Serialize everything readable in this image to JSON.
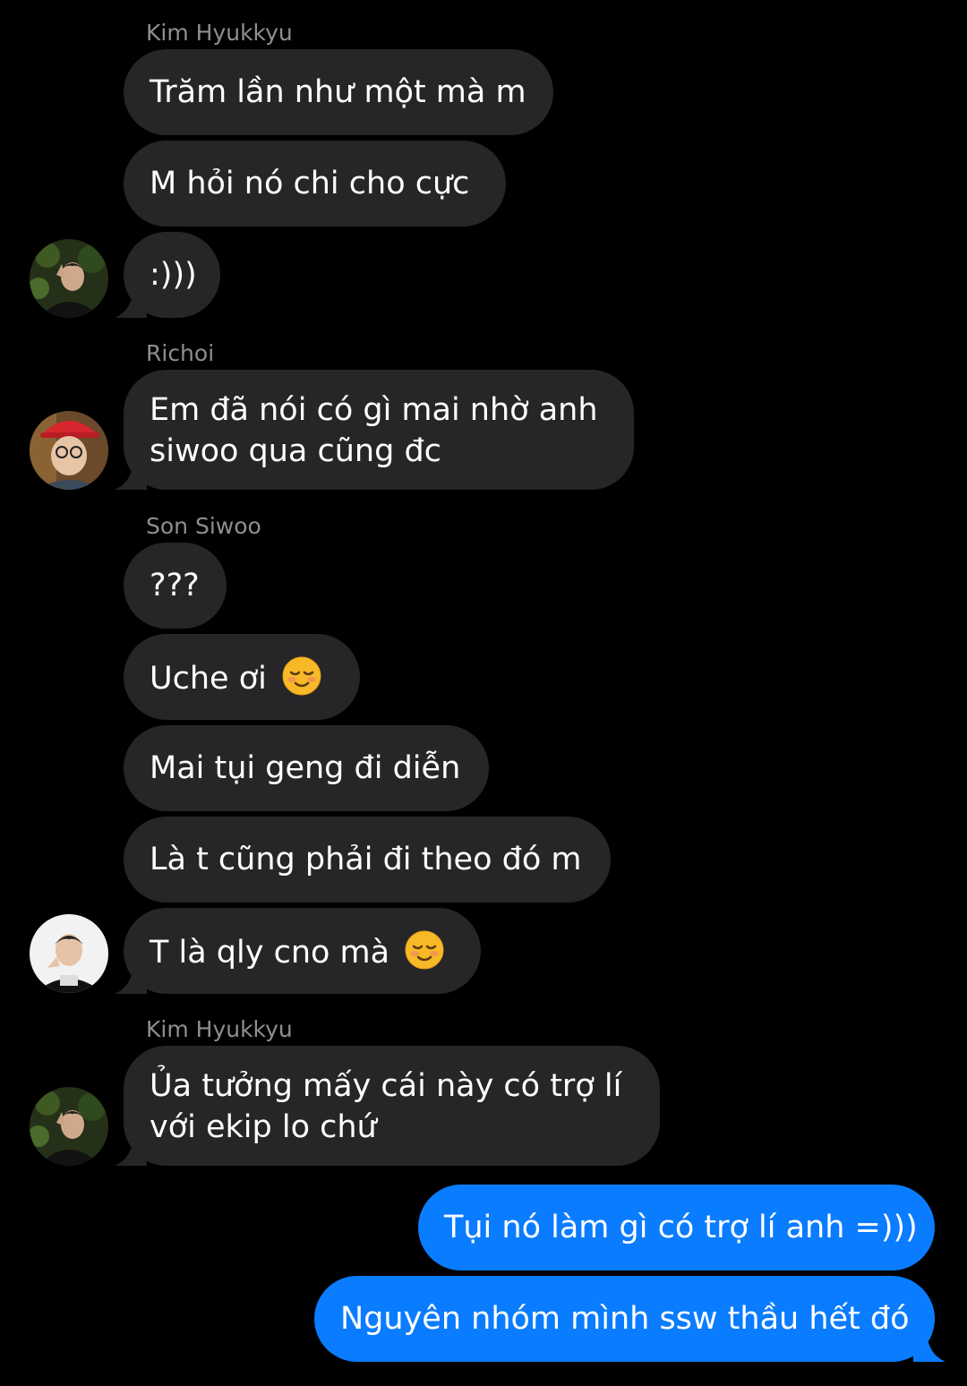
{
  "messages": {
    "s1_name": "Kim Hyukkyu",
    "m1": "Trăm lần như một mà m",
    "m2": "M hỏi nó chi cho cực",
    "m3": ":)))",
    "s2_name": "Richoi",
    "m4_line1": "Em đã nói có gì mai nhờ anh",
    "m4_line2": "siwoo qua cũng đc",
    "s3_name": "Son Siwoo",
    "m5": "???",
    "m6": "Uche ơi",
    "m7": "Mai tụi geng đi diễn",
    "m8": "Là t cũng phải đi theo đó m",
    "m9": "T là qly cno mà",
    "s4_name": "Kim Hyukkyu",
    "m10_line1": "Ủa tưởng mấy cái này có trợ lí",
    "m10_line2": "với ekip lo chứ",
    "out1": "Tụi nó làm gì có trợ lí anh =)))",
    "out2": "Nguyên nhóm mình ssw thầu hết đó"
  },
  "emoji": "smiling-face-icon",
  "colors": {
    "background": "#000000",
    "incoming_bubble": "#262628",
    "outgoing_bubble": "#0a7cff",
    "sender_name": "#8e8e93",
    "text": "#ffffff"
  }
}
